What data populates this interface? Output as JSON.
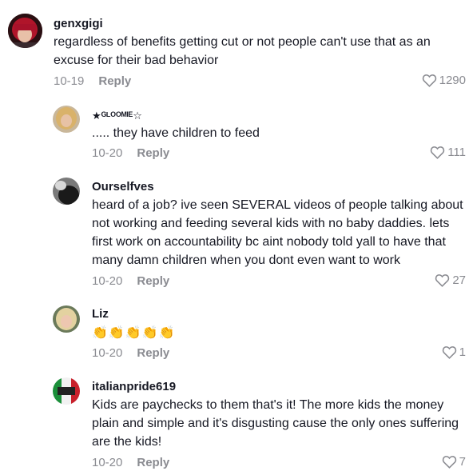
{
  "comments": [
    {
      "username": "genxgigi",
      "text": "regardless of benefits getting cut or not people can't use that as an excuse for their bad behavior",
      "date": "10-19",
      "reply_label": "Reply",
      "likes": "1290",
      "avatar_icon": "red-hair-avatar"
    },
    {
      "username": "★ᴳᴸᴼᴼᴹᴵᴱ☆",
      "text": "..... they have children to feed",
      "date": "10-20",
      "reply_label": "Reply",
      "likes": "111",
      "avatar_icon": "blonde-woman-avatar"
    },
    {
      "username": "Ourselfves",
      "text": "heard of a job? ive seen SEVERAL videos of people talking about not working and feeding several kids with no baby daddies. lets first work on accountability bc aint nobody told yall to have that many damn children when you dont even want to work",
      "date": "10-20",
      "reply_label": "Reply",
      "likes": "27",
      "avatar_icon": "dog-avatar"
    },
    {
      "username": "Liz",
      "text": "👏👏👏👏👏",
      "date": "10-20",
      "reply_label": "Reply",
      "likes": "1",
      "avatar_icon": "blonde-woman-avatar"
    },
    {
      "username": "italianpride619",
      "text": "Kids are paychecks to them that's it! The more kids the money plain and simple and it's disgusting cause the only ones suffering are the kids!",
      "date": "10-20",
      "reply_label": "Reply",
      "likes": "7",
      "avatar_icon": "italian-flag-avatar"
    }
  ],
  "colors": {
    "text": "#161823",
    "meta": "#8a8b91",
    "background": "#ffffff"
  }
}
